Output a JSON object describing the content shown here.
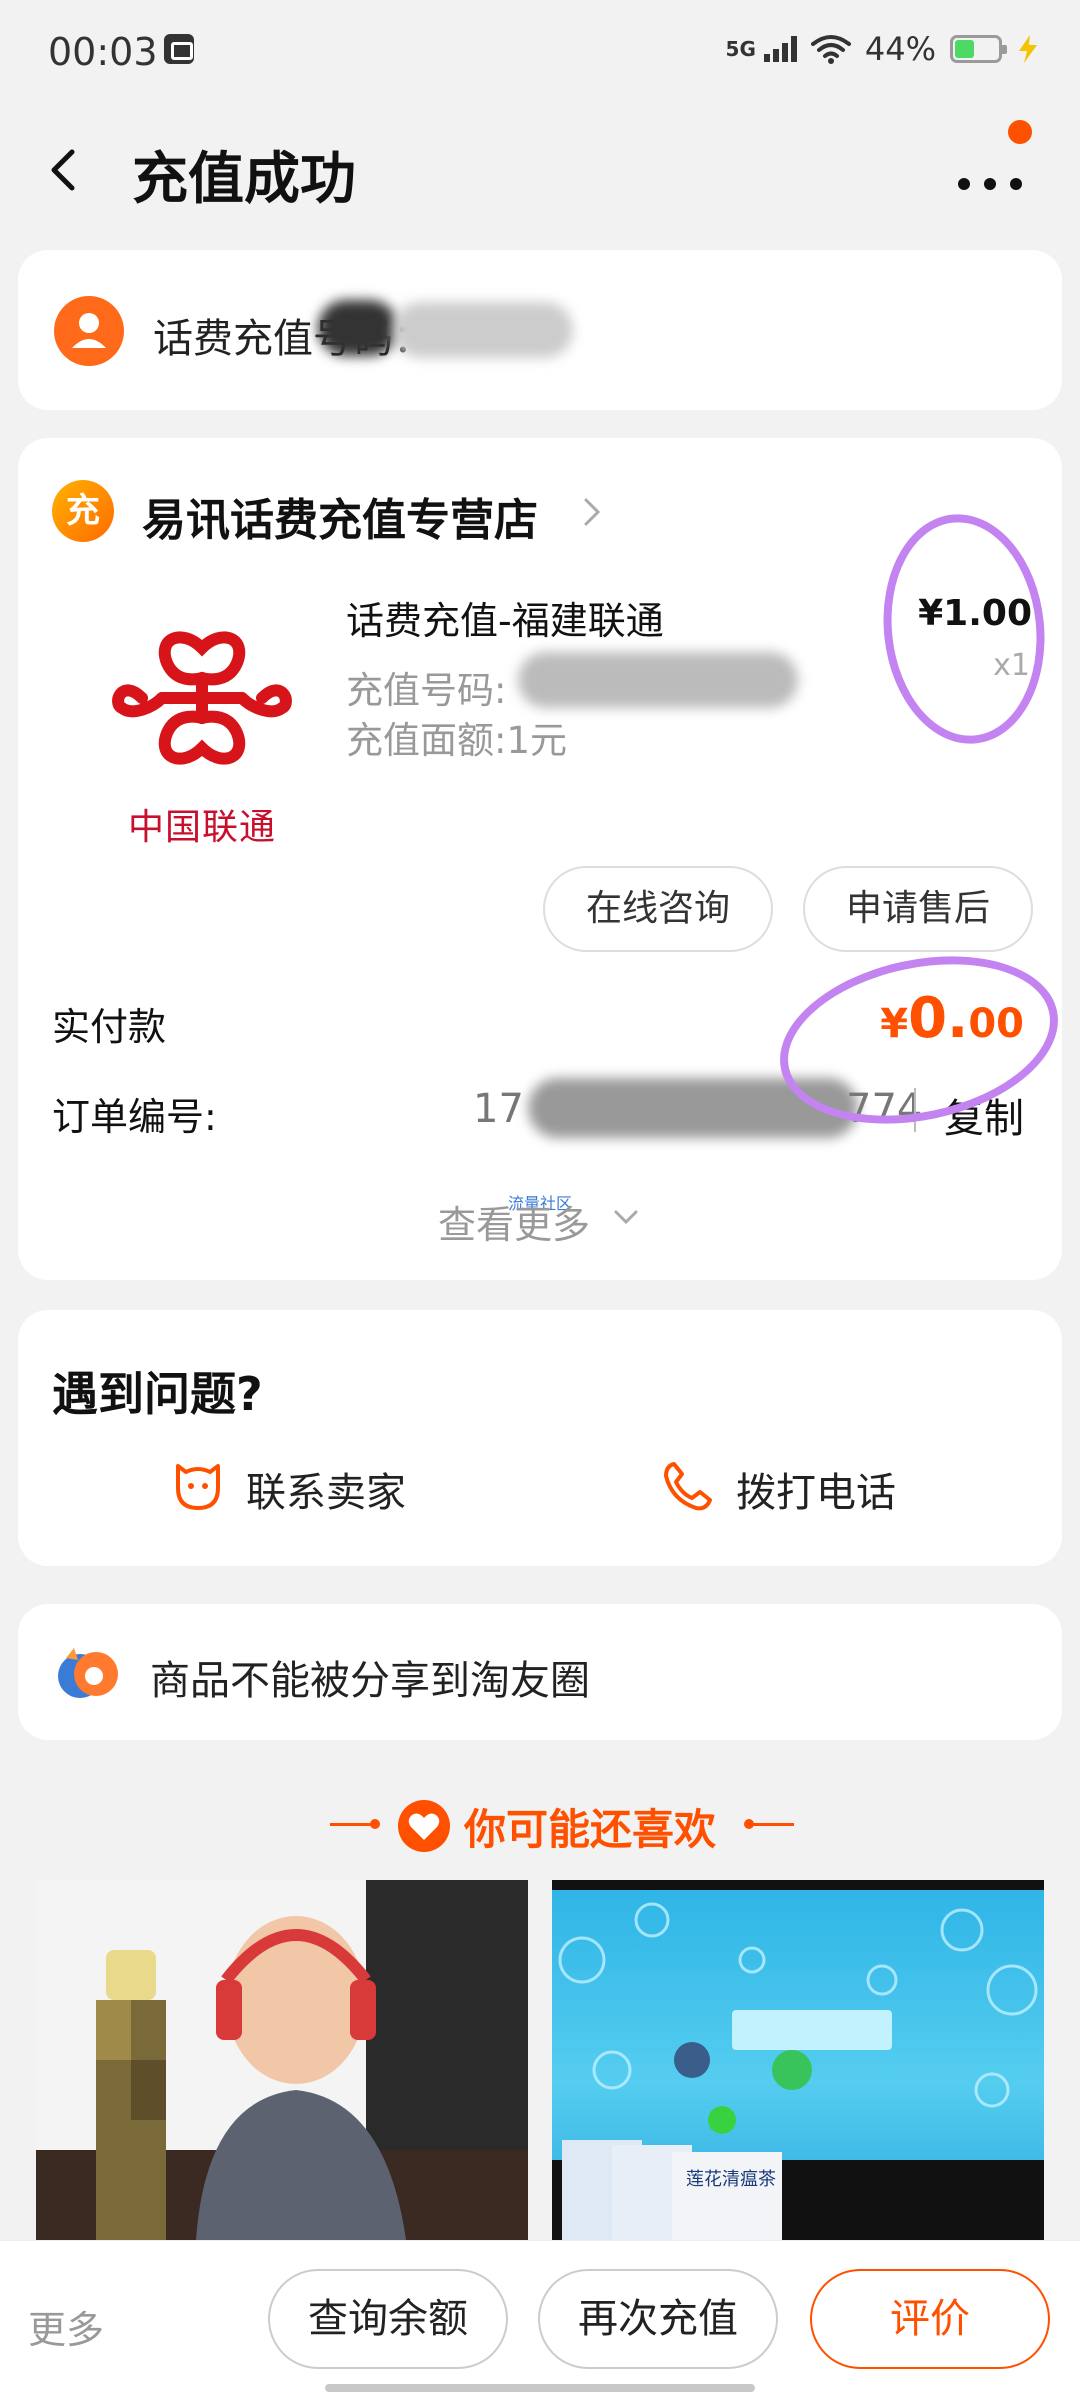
{
  "status_bar": {
    "time": "00:03",
    "network": "5G",
    "battery_percent": "44%",
    "battery_level": 0.44,
    "icons": [
      "gallery-icon",
      "signal-icon",
      "wifi-icon",
      "battery-icon",
      "charging-icon"
    ]
  },
  "header": {
    "title": "充值成功",
    "back_icon": "back-arrow-icon",
    "more_icon": "more-icon"
  },
  "phone_card": {
    "label": "话费充值号码："
  },
  "order": {
    "shop_icon_text": "充",
    "shop_name": "易讯话费充值专营店",
    "logo_text": "中国联通",
    "product_title": "话费充值-福建联通",
    "recharge_number_label": "充值号码:",
    "recharge_amount_text": "充值面额:1元",
    "price": "¥1.00",
    "quantity": "x1",
    "buttons": {
      "consult": "在线咨询",
      "after_sale": "申请售后"
    },
    "paid_label": "实付款",
    "paid_currency": "¥",
    "paid_major": "0.",
    "paid_minor": "00",
    "order_no_label": "订单编号:",
    "order_no_prefix": "17",
    "order_no_suffix": "774",
    "copy_label": "复制",
    "view_more": "查看更多",
    "watermark": "流量社区"
  },
  "problem": {
    "title": "遇到问题?",
    "contact_seller": "联系卖家",
    "call_phone": "拨打电话"
  },
  "share": {
    "text": "商品不能被分享到淘友圈"
  },
  "recommend": {
    "title": "你可能还喜欢",
    "product_box_text": "莲花清瘟茶"
  },
  "bottom_bar": {
    "more": "更多",
    "check_balance": "查询余额",
    "recharge_again": "再次充值",
    "review": "评价"
  },
  "colors": {
    "accent": "#ff5000",
    "unicom_red": "#c8102e",
    "annotation": "#c383f0",
    "background": "#f2f2f2"
  }
}
